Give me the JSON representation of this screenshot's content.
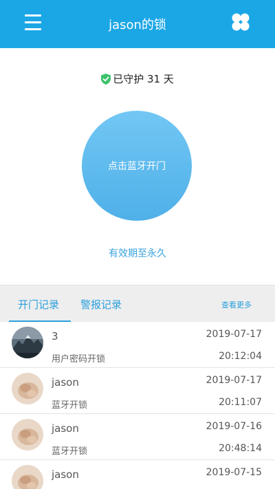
{
  "header": {
    "title": "jason的锁",
    "background": "#1ba7e6",
    "left_icon": "menu-icon",
    "right_icon": "grid-icon"
  },
  "guard": {
    "text": "已守护 31 天",
    "icon": "shield-check-icon",
    "icon_color": "#3cc26b"
  },
  "unlock": {
    "label": "点击蓝牙开门"
  },
  "validity": "有效期至永久",
  "tabs": {
    "items": [
      {
        "label": "开门记录",
        "active": true
      },
      {
        "label": "警报记录",
        "active": false
      }
    ],
    "more_label": "查看更多",
    "accent": "#2a9fdc"
  },
  "records": [
    {
      "name": "3",
      "method": "用户密码开锁",
      "date": "2019-07-17",
      "time": "20:12:04",
      "avatar": "mountain-avatar"
    },
    {
      "name": "jason",
      "method": "蓝牙开锁",
      "date": "2019-07-17",
      "time": "20:11:07",
      "avatar": "hands-avatar"
    },
    {
      "name": "jason",
      "method": "蓝牙开锁",
      "date": "2019-07-16",
      "time": "20:48:14",
      "avatar": "hands-avatar"
    },
    {
      "name": "jason",
      "method": "",
      "date": "2019-07-15",
      "time": "",
      "avatar": "hands-avatar"
    }
  ]
}
